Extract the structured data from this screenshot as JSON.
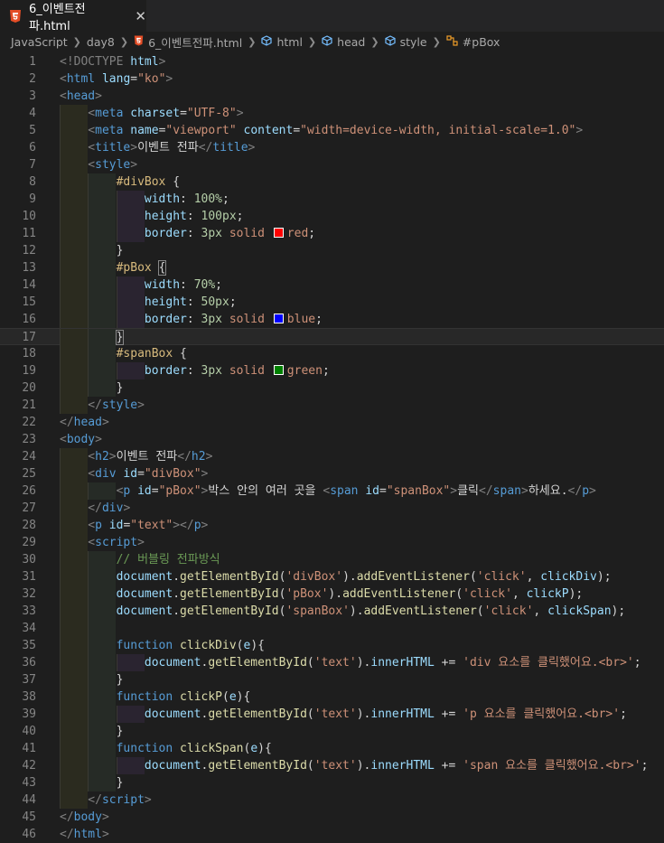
{
  "tab": {
    "title": "6_이벤트전파.html",
    "close": "✕"
  },
  "breadcrumb": [
    "JavaScript",
    "day8",
    "6_이벤트전파.html",
    "html",
    "head",
    "style",
    "#pBox"
  ],
  "colors": {
    "red": "#ff0000",
    "blue": "#0000ff",
    "green": "#008000"
  },
  "lines": [
    "1",
    "2",
    "3",
    "4",
    "5",
    "6",
    "7",
    "8",
    "9",
    "10",
    "11",
    "12",
    "13",
    "14",
    "15",
    "16",
    "17",
    "18",
    "19",
    "20",
    "21",
    "22",
    "23",
    "24",
    "25",
    "26",
    "27",
    "28",
    "29",
    "30",
    "31",
    "32",
    "33",
    "34",
    "35",
    "36",
    "37",
    "38",
    "39",
    "40",
    "41",
    "42",
    "43",
    "44",
    "45",
    "46"
  ],
  "code": {
    "l1": [
      "<!DOCTYPE",
      " html",
      ">"
    ],
    "l2": [
      "<",
      "html",
      " lang",
      "=",
      "\"ko\"",
      ">"
    ],
    "l3": [
      "<",
      "head",
      ">"
    ],
    "l4": [
      "<",
      "meta",
      " charset",
      "=",
      "\"UTF-8\"",
      ">"
    ],
    "l5": [
      "<",
      "meta",
      " name",
      "=",
      "\"viewport\"",
      " content",
      "=",
      "\"width=device-width, initial-scale=1.0\"",
      ">"
    ],
    "l6": [
      "<",
      "title",
      ">",
      "이벤트 전파",
      "</",
      "title",
      ">"
    ],
    "l7": [
      "<",
      "style",
      ">"
    ],
    "l8": [
      "#divBox",
      " {"
    ],
    "l9": [
      "width",
      ": ",
      "100%",
      ";"
    ],
    "l10": [
      "height",
      ": ",
      "100px",
      ";"
    ],
    "l11": [
      "border",
      ": ",
      "3px",
      " solid ",
      "red",
      ";"
    ],
    "l12": [
      "}"
    ],
    "l13": [
      "#pBox",
      " ",
      "{"
    ],
    "l14": [
      "width",
      ": ",
      "70%",
      ";"
    ],
    "l15": [
      "height",
      ": ",
      "50px",
      ";"
    ],
    "l16": [
      "border",
      ": ",
      "3px",
      " solid ",
      "blue",
      ";"
    ],
    "l17": [
      "}"
    ],
    "l18": [
      "#spanBox",
      " {"
    ],
    "l19": [
      "border",
      ": ",
      "3px",
      " solid ",
      "green",
      ";"
    ],
    "l20": [
      "}"
    ],
    "l21": [
      "</",
      "style",
      ">"
    ],
    "l22": [
      "</",
      "head",
      ">"
    ],
    "l23": [
      "<",
      "body",
      ">"
    ],
    "l24": [
      "<",
      "h2",
      ">",
      "이벤트 전파",
      "</",
      "h2",
      ">"
    ],
    "l25": [
      "<",
      "div",
      " id",
      "=",
      "\"divBox\"",
      ">"
    ],
    "l26": [
      "<",
      "p",
      " id",
      "=",
      "\"pBox\"",
      ">",
      "박스 안의 여러 곳을 ",
      "<",
      "span",
      " id",
      "=",
      "\"spanBox\"",
      ">",
      "클릭",
      "</",
      "span",
      ">",
      "하세요.",
      "</",
      "p",
      ">"
    ],
    "l27": [
      "</",
      "div",
      ">"
    ],
    "l28": [
      "<",
      "p",
      " id",
      "=",
      "\"text\"",
      "></",
      "p",
      ">"
    ],
    "l29": [
      "<",
      "script",
      ">"
    ],
    "l30": [
      "// 버블링 전파방식"
    ],
    "l31": [
      "document",
      ".",
      "getElementById",
      "(",
      "'divBox'",
      ").",
      "addEventListener",
      "(",
      "'click'",
      ", ",
      "clickDiv",
      ");"
    ],
    "l32": [
      "document",
      ".",
      "getElementById",
      "(",
      "'pBox'",
      ").",
      "addEventListener",
      "(",
      "'click'",
      ", ",
      "clickP",
      ");"
    ],
    "l33": [
      "document",
      ".",
      "getElementById",
      "(",
      "'spanBox'",
      ").",
      "addEventListener",
      "(",
      "'click'",
      ", ",
      "clickSpan",
      ");"
    ],
    "l34": [
      ""
    ],
    "l35": [
      "function",
      " ",
      "clickDiv",
      "(",
      "e",
      "){"
    ],
    "l36": [
      "document",
      ".",
      "getElementById",
      "(",
      "'text'",
      ").",
      "innerHTML",
      " += ",
      "'div 요소를 클릭했어요.<br>'",
      ";"
    ],
    "l37": [
      "}"
    ],
    "l38": [
      "function",
      " ",
      "clickP",
      "(",
      "e",
      "){"
    ],
    "l39": [
      "document",
      ".",
      "getElementById",
      "(",
      "'text'",
      ").",
      "innerHTML",
      " += ",
      "'p 요소를 클릭했어요.<br>'",
      ";"
    ],
    "l40": [
      "}"
    ],
    "l41": [
      "function",
      " ",
      "clickSpan",
      "(",
      "e",
      "){"
    ],
    "l42": [
      "document",
      ".",
      "getElementById",
      "(",
      "'text'",
      ").",
      "innerHTML",
      " += ",
      "'span 요소를 클릭했어요.<br>'",
      ";"
    ],
    "l43": [
      "}"
    ],
    "l44": [
      "</",
      "script",
      ">"
    ],
    "l45": [
      "</",
      "body",
      ">"
    ],
    "l46": [
      "</",
      "html",
      ">"
    ]
  }
}
